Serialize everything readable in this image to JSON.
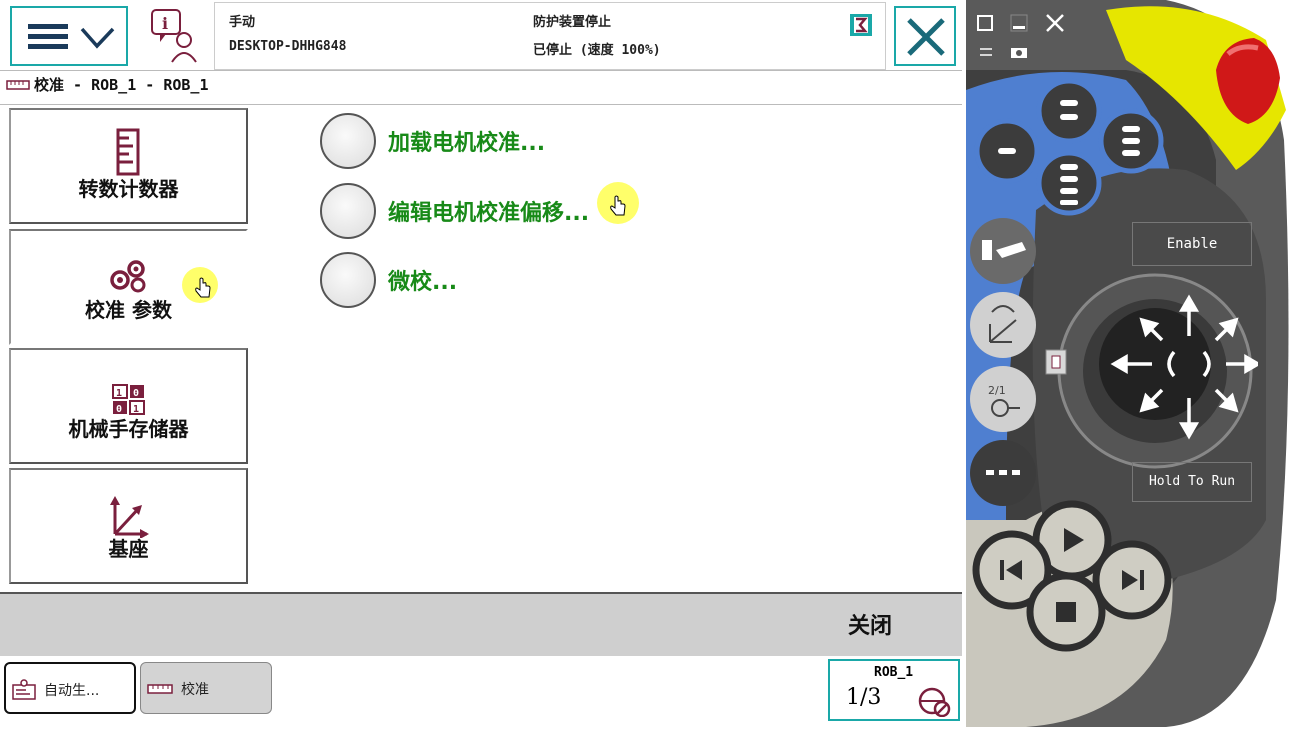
{
  "header": {
    "mode": "手动",
    "system_name": "DESKTOP-DHHG848",
    "safety_status": "防护装置停止",
    "run_status": "已停止 (速度 100%)"
  },
  "breadcrumb": "校准 - ROB_1 - ROB_1",
  "sidebar": {
    "items": [
      {
        "label": "转数计数器"
      },
      {
        "label": "校准 参数"
      },
      {
        "label": "机械手存储器"
      },
      {
        "label": "基座"
      }
    ]
  },
  "options": [
    {
      "label": "加载电机校准..."
    },
    {
      "label": "编辑电机校准偏移..."
    },
    {
      "label": "微校..."
    }
  ],
  "command_bar": {
    "close_label": "关闭"
  },
  "taskbar": {
    "tasks": [
      {
        "label": "自动生..."
      },
      {
        "label": "校准"
      }
    ],
    "quickset": {
      "robot": "ROB_1",
      "fraction": "1/3"
    }
  },
  "pendant": {
    "enable_label": "Enable",
    "hold_to_run_label": "Hold To Run"
  },
  "colors": {
    "accent_teal": "#1aa8a8",
    "option_green": "#188a18",
    "icon_maroon": "#7a1f3d",
    "pendant_blue": "#4f7fd0",
    "emergency_red": "#d01818",
    "pendant_yellow": "#e6e600"
  }
}
